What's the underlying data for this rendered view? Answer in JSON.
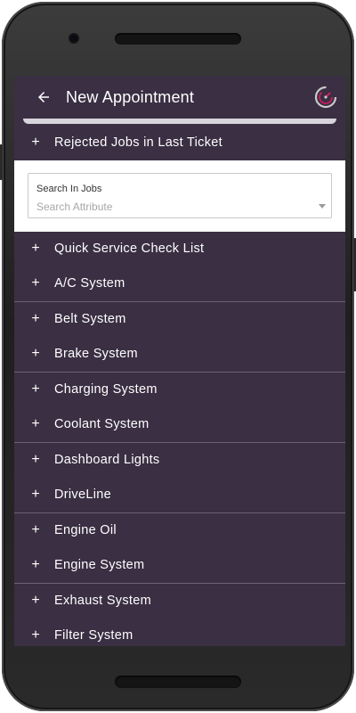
{
  "appbar": {
    "title": "New Appointment",
    "back_icon": "arrow-left-icon",
    "logo_icon": "speedometer-logo-icon"
  },
  "rejected": {
    "label": "Rejected Jobs in Last Ticket"
  },
  "search": {
    "label": "Search In Jobs",
    "placeholder": "Search Attribute"
  },
  "sections": [
    {
      "label": "Quick Service Check List"
    },
    {
      "label": "A/C System"
    },
    {
      "label": "Belt System"
    },
    {
      "label": "Brake System"
    },
    {
      "label": "Charging System"
    },
    {
      "label": "Coolant System"
    },
    {
      "label": "Dashboard Lights"
    },
    {
      "label": "DriveLine"
    },
    {
      "label": "Engine Oil"
    },
    {
      "label": "Engine System"
    },
    {
      "label": "Exhaust System"
    },
    {
      "label": "Filter System"
    }
  ],
  "expand_symbol": "+",
  "colors": {
    "appbar": "#3a2f43",
    "list_background": "#3a2f43",
    "accent": "#d81b60",
    "text": "#ffffff"
  }
}
